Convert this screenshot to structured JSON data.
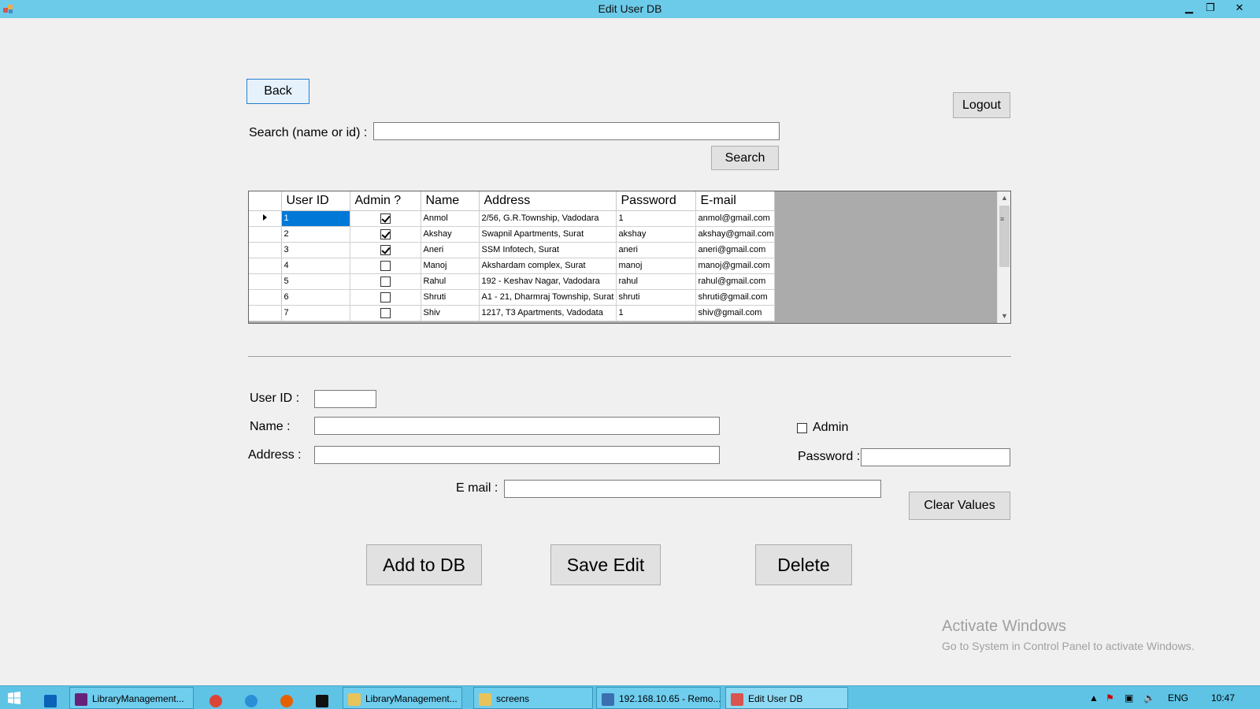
{
  "window": {
    "title": "Edit User DB"
  },
  "window_controls": {
    "minimize": "▁",
    "maximize": "❐",
    "close": "✕"
  },
  "buttons": {
    "back": "Back",
    "logout": "Logout",
    "search": "Search",
    "clear": "Clear Values",
    "add": "Add to DB",
    "save": "Save Edit",
    "delete": "Delete"
  },
  "search": {
    "label": "Search (name or id) :",
    "value": ""
  },
  "grid": {
    "columns": [
      "User ID",
      "Admin ?",
      "Name",
      "Address",
      "Password",
      "E-mail"
    ],
    "rows": [
      {
        "id": "1",
        "admin": true,
        "name": "Anmol",
        "address": "2/56, G.R.Township, Vadodara",
        "password": "1",
        "email": "anmol@gmail.com"
      },
      {
        "id": "2",
        "admin": true,
        "name": "Akshay",
        "address": "Swapnil Apartments, Surat",
        "password": "akshay",
        "email": "akshay@gmail.com"
      },
      {
        "id": "3",
        "admin": true,
        "name": "Aneri",
        "address": "SSM Infotech, Surat",
        "password": "aneri",
        "email": "aneri@gmail.com"
      },
      {
        "id": "4",
        "admin": false,
        "name": "Manoj",
        "address": "Akshardam complex, Surat",
        "password": "manoj",
        "email": "manoj@gmail.com"
      },
      {
        "id": "5",
        "admin": false,
        "name": "Rahul",
        "address": "192 - Keshav Nagar, Vadodara",
        "password": "rahul",
        "email": "rahul@gmail.com"
      },
      {
        "id": "6",
        "admin": false,
        "name": "Shruti",
        "address": "A1 - 21, Dharmraj Township, Surat",
        "password": "shruti",
        "email": "shruti@gmail.com"
      },
      {
        "id": "7",
        "admin": false,
        "name": "Shiv",
        "address": "1217, T3 Apartments, Vadodata",
        "password": "1",
        "email": "shiv@gmail.com"
      }
    ],
    "selected_row": 0
  },
  "form": {
    "user_id_label": "User ID :",
    "name_label": "Name :",
    "address_label": "Address :",
    "email_label": "E mail :",
    "admin_label": "Admin",
    "password_label": "Password :",
    "user_id_value": "",
    "name_value": "",
    "address_value": "",
    "email_value": "",
    "password_value": "",
    "admin_checked": false
  },
  "watermark": {
    "line1": "Activate Windows",
    "line2": "Go to System in Control Panel to activate Windows."
  },
  "taskbar": {
    "items": [
      {
        "label": "LibraryManagement...",
        "icon": "visual-studio-icon",
        "color": "#68217a"
      },
      {
        "label": "LibraryManagement...",
        "icon": "folder-icon",
        "color": "#e8c35a"
      },
      {
        "label": "screens",
        "icon": "folder-icon",
        "color": "#e8c35a"
      },
      {
        "label": "192.168.10.65 - Remo...",
        "icon": "remote-desktop-icon",
        "color": "#3a6fb0"
      },
      {
        "label": "Edit User DB",
        "icon": "app-window-icon",
        "color": "#d9534f"
      }
    ],
    "tray": {
      "language": "ENG",
      "time": "10:47"
    }
  }
}
